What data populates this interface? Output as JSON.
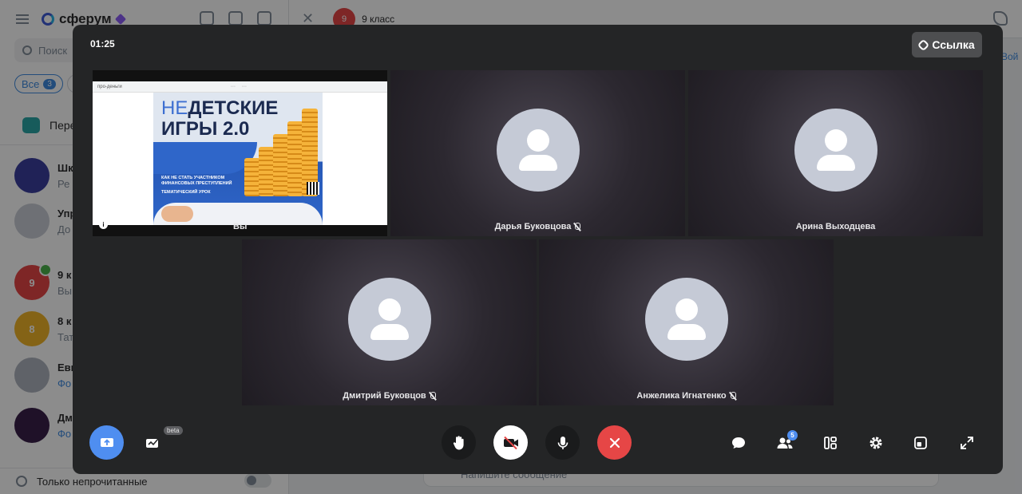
{
  "app": {
    "logo_text": "сферум",
    "search_placeholder": "Поиск",
    "filter_all_label": "Все",
    "filter_all_count": "3",
    "pinned_label": "Пере",
    "chats": [
      {
        "avatar_text": "",
        "avatar_color": "#3b3f9e",
        "name": "Шк",
        "preview": "Ре",
        "preview_blue": false
      },
      {
        "avatar_text": "",
        "avatar_color": "#c9cdd6",
        "name": "Упр",
        "preview": "До",
        "preview_blue": false
      },
      {
        "avatar_text": "9",
        "avatar_color": "#e64646",
        "name": "9 к",
        "preview": "Вы",
        "preview_blue": false
      },
      {
        "avatar_text": "8",
        "avatar_color": "#f0b429",
        "name": "8 к",
        "preview": "Тат",
        "preview_blue": false
      },
      {
        "avatar_text": "",
        "avatar_color": "#aeb3bd",
        "name": "Евг",
        "preview": "Фо",
        "preview_blue": true
      },
      {
        "avatar_text": "",
        "avatar_color": "#3a1f4a",
        "name": "Дм",
        "preview": "Фо",
        "preview_blue": true
      }
    ],
    "unread_only_label": "Только непрочитанные",
    "chat_header_avatar": "9",
    "chat_header_title": "9 класс",
    "right_link_text": "Вой",
    "composer_placeholder": "Напишите сообщение"
  },
  "call": {
    "timer": "01:25",
    "link_button_label": "Ссылка",
    "share_tile": {
      "url_text": "про-деньги",
      "poster_ne": "НЕ",
      "poster_title1": "ДЕТСКИЕ",
      "poster_title2": "ИГРЫ 2.0",
      "poster_subtitle": "КАК НЕ СТАТЬ УЧАСТНИКОМ ФИНАНСОВЫХ ПРЕСТУПЛЕНИЙ",
      "poster_tag": "ТЕМАТИЧЕСКИЙ УРОК",
      "info_icon_text": "i",
      "presenter_name": "Вы"
    },
    "participants": [
      {
        "name": "Дарья Буковцова",
        "mic_muted": true
      },
      {
        "name": "Арина Выходцева",
        "mic_muted": false
      },
      {
        "name": "Дмитрий Буковцов",
        "mic_muted": true
      },
      {
        "name": "Анжелика Игнатенко",
        "mic_muted": true
      }
    ],
    "controls": {
      "beta_label": "beta",
      "participants_count": "5"
    },
    "colors": {
      "end_call": "#e64646",
      "share_active": "#4f8ef0",
      "modal_bg": "#242526"
    }
  }
}
